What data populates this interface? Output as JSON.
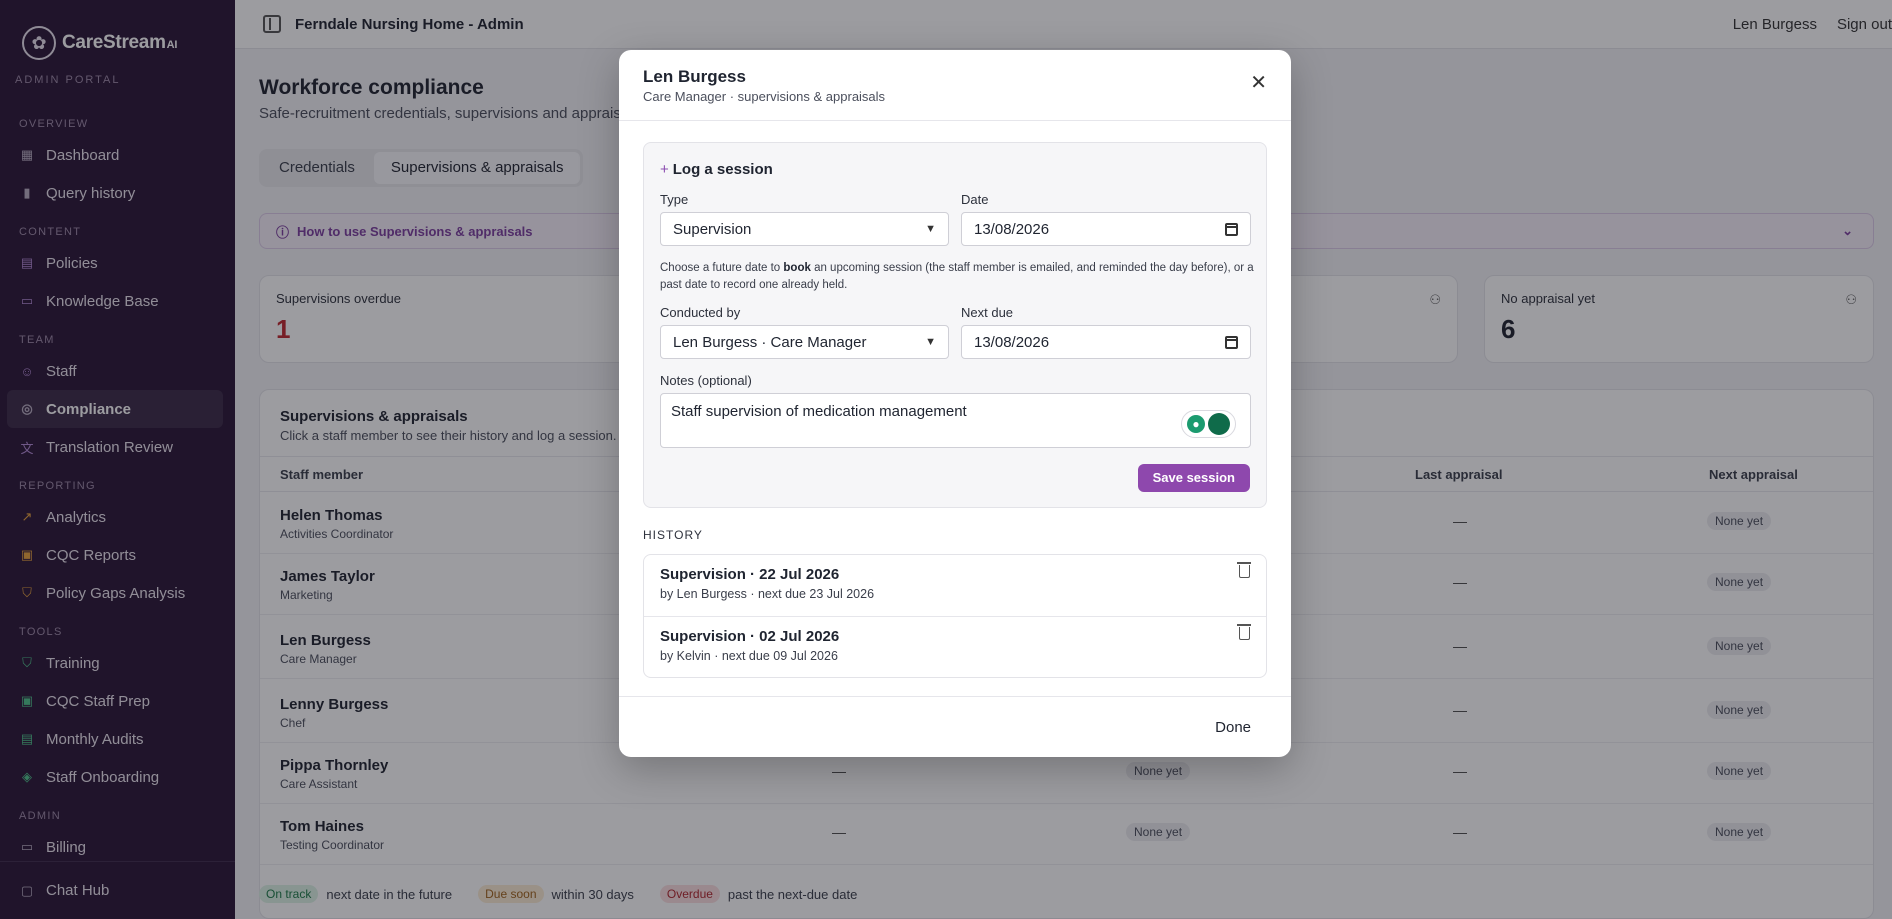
{
  "sidebar": {
    "brand": "CareStream",
    "brand_suffix": "AI",
    "portal": "ADMIN PORTAL",
    "sections": [
      {
        "title": "OVERVIEW",
        "items": [
          {
            "label": "Dashboard",
            "icon": "grid-icon"
          },
          {
            "label": "Query history",
            "icon": "bar-chart-icon"
          }
        ]
      },
      {
        "title": "CONTENT",
        "items": [
          {
            "label": "Policies",
            "icon": "document-icon"
          },
          {
            "label": "Knowledge Base",
            "icon": "book-icon"
          }
        ]
      },
      {
        "title": "TEAM",
        "items": [
          {
            "label": "Staff",
            "icon": "users-icon"
          },
          {
            "label": "Compliance",
            "icon": "check-circle-icon",
            "active": true
          },
          {
            "label": "Translation Review",
            "icon": "translate-icon"
          }
        ]
      },
      {
        "title": "REPORTING",
        "items": [
          {
            "label": "Analytics",
            "icon": "trend-icon"
          },
          {
            "label": "CQC Reports",
            "icon": "clipboard-icon"
          },
          {
            "label": "Policy Gaps Analysis",
            "icon": "shield-icon"
          }
        ]
      },
      {
        "title": "TOOLS",
        "items": [
          {
            "label": "Training",
            "icon": "shield-check-icon"
          },
          {
            "label": "CQC Staff Prep",
            "icon": "clipboard-check-icon"
          },
          {
            "label": "Monthly Audits",
            "icon": "clipboard-list-icon"
          },
          {
            "label": "Staff Onboarding",
            "icon": "graduation-cap-icon"
          }
        ]
      },
      {
        "title": "ADMIN",
        "items": [
          {
            "label": "Billing",
            "icon": "card-icon"
          }
        ]
      }
    ],
    "chat_hub": "Chat Hub"
  },
  "topbar": {
    "title": "Ferndale Nursing Home - Admin",
    "user": "Len Burgess",
    "sign_out": "Sign out"
  },
  "main": {
    "title": "Workforce compliance",
    "subtitle": "Safe-recruitment credentials, supervisions and apprais",
    "tabs": [
      "Credentials",
      "Supervisions & appraisals"
    ],
    "howto": "How to use Supervisions & appraisals",
    "stats": [
      {
        "label": "Supervisions overdue",
        "value": "1"
      },
      {
        "label": "No appraisal yet",
        "value": "6"
      }
    ],
    "table": {
      "title": "Supervisions & appraisals",
      "subtitle": "Click a staff member to see their history and log a session.",
      "headers": {
        "staff": "Staff member",
        "last_appraisal": "Last appraisal",
        "next_appraisal": "Next appraisal"
      },
      "rows": [
        {
          "name": "Helen Thomas",
          "role": "Activities Coordinator",
          "c1": "",
          "c2": "",
          "last": "—",
          "next": "None yet"
        },
        {
          "name": "James Taylor",
          "role": "Marketing",
          "c1": "",
          "c2": "",
          "last": "—",
          "next": "None yet"
        },
        {
          "name": "Len Burgess",
          "role": "Care Manager",
          "c1": "",
          "c2": "",
          "last": "—",
          "next": "None yet"
        },
        {
          "name": "Lenny Burgess",
          "role": "Chef",
          "c1": "",
          "c2": "",
          "last": "—",
          "next": "None yet"
        },
        {
          "name": "Pippa Thornley",
          "role": "Care Assistant",
          "c1": "—",
          "c2": "None yet",
          "last": "—",
          "next": "None yet"
        },
        {
          "name": "Tom Haines",
          "role": "Testing Coordinator",
          "c1": "—",
          "c2": "None yet",
          "last": "—",
          "next": "None yet"
        }
      ]
    },
    "legend": [
      {
        "badge": "On track",
        "text": "next date in the future"
      },
      {
        "badge": "Due soon",
        "text": "within 30 days"
      },
      {
        "badge": "Overdue",
        "text": "past the next-due date"
      }
    ]
  },
  "modal": {
    "name": "Len Burgess",
    "role": "Care Manager · supervisions & appraisals",
    "log_title": "Log a session",
    "type_label": "Type",
    "type_value": "Supervision",
    "date_label": "Date",
    "date_value": "13/08/2026",
    "hint_pre": "Choose a future date to ",
    "hint_bold": "book",
    "hint_post": " an upcoming session (the staff member is emailed, and reminded the day before), or a past date to record one already held.",
    "conducted_label": "Conducted by",
    "conducted_value": "Len Burgess · Care Manager",
    "next_due_label": "Next due",
    "next_due_value": "13/08/2026",
    "notes_label": "Notes (optional)",
    "notes_value": "Staff supervision of medication management",
    "save": "Save session",
    "history_title": "HISTORY",
    "history": [
      {
        "title": "Supervision · 22 Jul 2026",
        "sub": "by Len Burgess · next due 23 Jul 2026"
      },
      {
        "title": "Supervision · 02 Jul 2026",
        "sub": "by Kelvin · next due 09 Jul 2026"
      }
    ],
    "done": "Done"
  },
  "colors": {
    "sidebar_bg": "#2a1636",
    "accent": "#8e48ad",
    "overdue": "#c0262d"
  }
}
